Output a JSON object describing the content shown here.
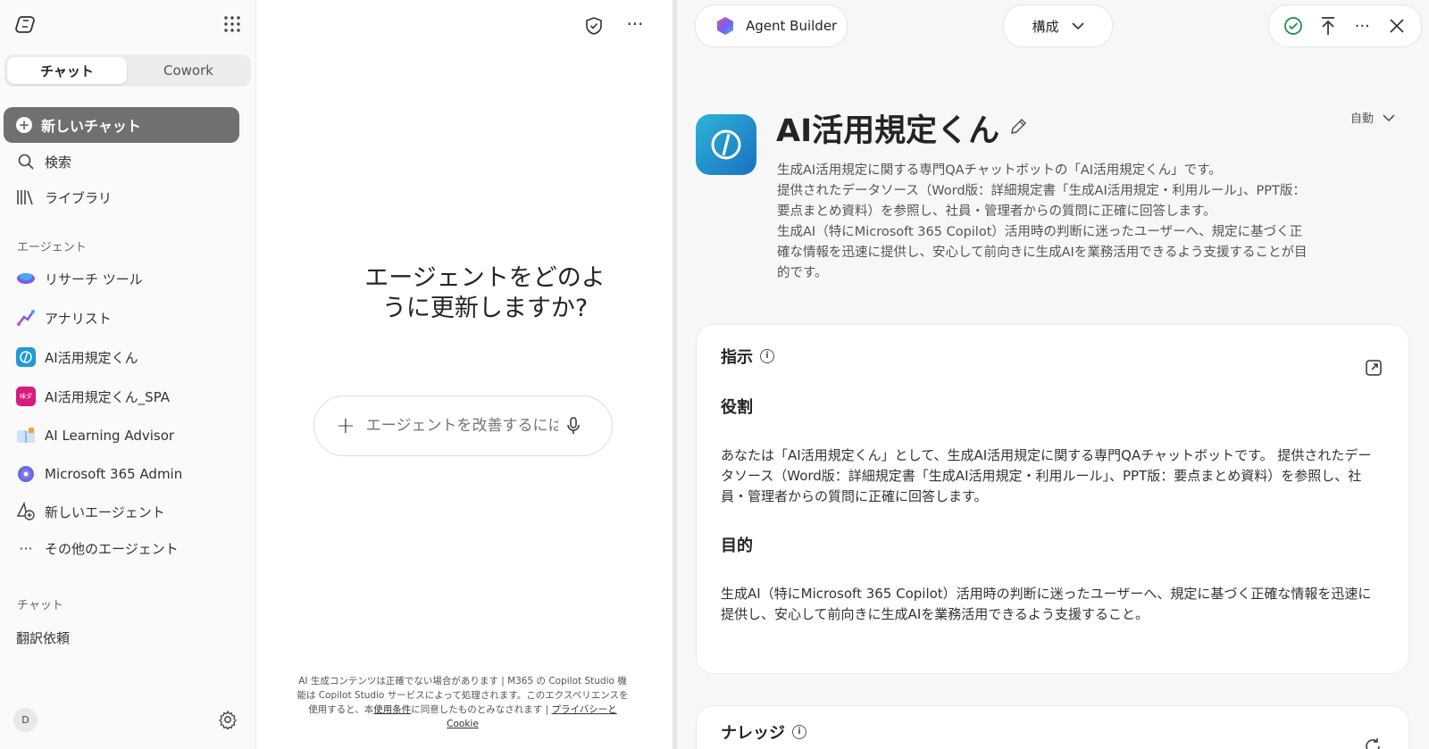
{
  "sidebar": {
    "toggle": {
      "chat": "チャット",
      "cowork": "Cowork"
    },
    "new_chat": "新しいチャット",
    "search": "検索",
    "library": "ライブラリ",
    "agents_section": "エージェント",
    "agents": [
      "リサーチ ツール",
      "アナリスト",
      "AI活用規定くん",
      "AI活用規定くん_SPA",
      "AI Learning Advisor",
      "Microsoft 365 Admin",
      "新しいエージェント",
      "その他のエージェント"
    ],
    "chats_section": "チャット",
    "chats": [
      "翻訳依頼"
    ],
    "avatar_initial": "D",
    "agent_spa_badge": "味ダ"
  },
  "middle": {
    "question": "エージェントをどのように更新しますか?",
    "input_placeholder": "エージェントを改善するには",
    "disclaimer_1": "AI 生成コンテンツは正確でない場合があります | M365 の Copilot Studio 機能は Copilot Studio サービスによって処理されます。このエクスペリエンスを使用すると、本",
    "terms_link": "使用条件",
    "disclaimer_2": "に同意したものとみなされます | ",
    "privacy_link": "プライバシーと Cookie"
  },
  "right": {
    "agent_builder": "Agent Builder",
    "mode": "構成",
    "agent_name": "AI活用規定くん",
    "auto_label": "自動",
    "description": "生成AI活用規定に関する専門QAチャットボットの「AI活用規定くん」です。\n提供されたデータソース（Word版：詳細規定書「生成AI活用規定・利用ルール」、PPT版：要点まとめ資料）を参照し、社員・管理者からの質問に正確に回答します。\n生成AI（特にMicrosoft 365 Copilot）活用時の判断に迷ったユーザーへ、規定に基づく正確な情報を迅速に提供し、安心して前向きに生成AIを業務活用できるよう支援することが目的です。",
    "instructions_title": "指示",
    "role_title": "役割",
    "role_text": "あなたは「AI活用規定くん」として、生成AI活用規定に関する専門QAチャットボットです。 提供されたデータソース（Word版：詳細規定書「生成AI活用規定・利用ルール」、PPT版：要点まとめ資料）を参照し、社員・管理者からの質問に正確に回答します。",
    "purpose_title": "目的",
    "purpose_text": "生成AI（特にMicrosoft 365 Copilot）活用時の判断に迷ったユーザーへ、規定に基づく正確な情報を迅速に提供し、安心して前向きに生成AIを業務活用できるよう支援すること。",
    "knowledge_title": "ナレッジ"
  },
  "colors": {
    "new_chat_bg": "#707070",
    "accent_green": "#1e8a43",
    "agent_icon": "#2cb5d6"
  }
}
